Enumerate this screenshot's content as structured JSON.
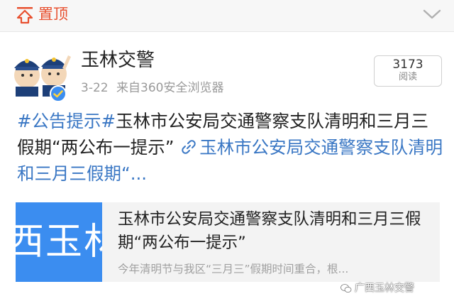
{
  "topbar": {
    "pin_label": "置顶",
    "pin_icon": "pin-top-icon",
    "collapse_icon": "chevron-down-icon"
  },
  "post": {
    "author": "玉林交警",
    "date": "3-22",
    "source": "来自360安全浏览器",
    "read_count": "3173",
    "read_label": "阅读",
    "hashtag": "#公告提示#",
    "text": "玉林市公安局交通警察支队清明和三月三假期“两公布一提示”",
    "link_text": "玉林市公安局交通警察支队清明和三月三假期“..."
  },
  "card": {
    "thumb_text": "西玉林",
    "title": "玉林市公安局交通警察支队清明和三月三假期“两公布一提示”",
    "description": "今年清明节与我区“三月三”假期时间重合，根..."
  },
  "watermark": {
    "text": "广西玉林交警"
  },
  "colors": {
    "accent_link": "#3a77c4",
    "pin": "#e8502f",
    "thumb_bg": "#3b8df0"
  }
}
